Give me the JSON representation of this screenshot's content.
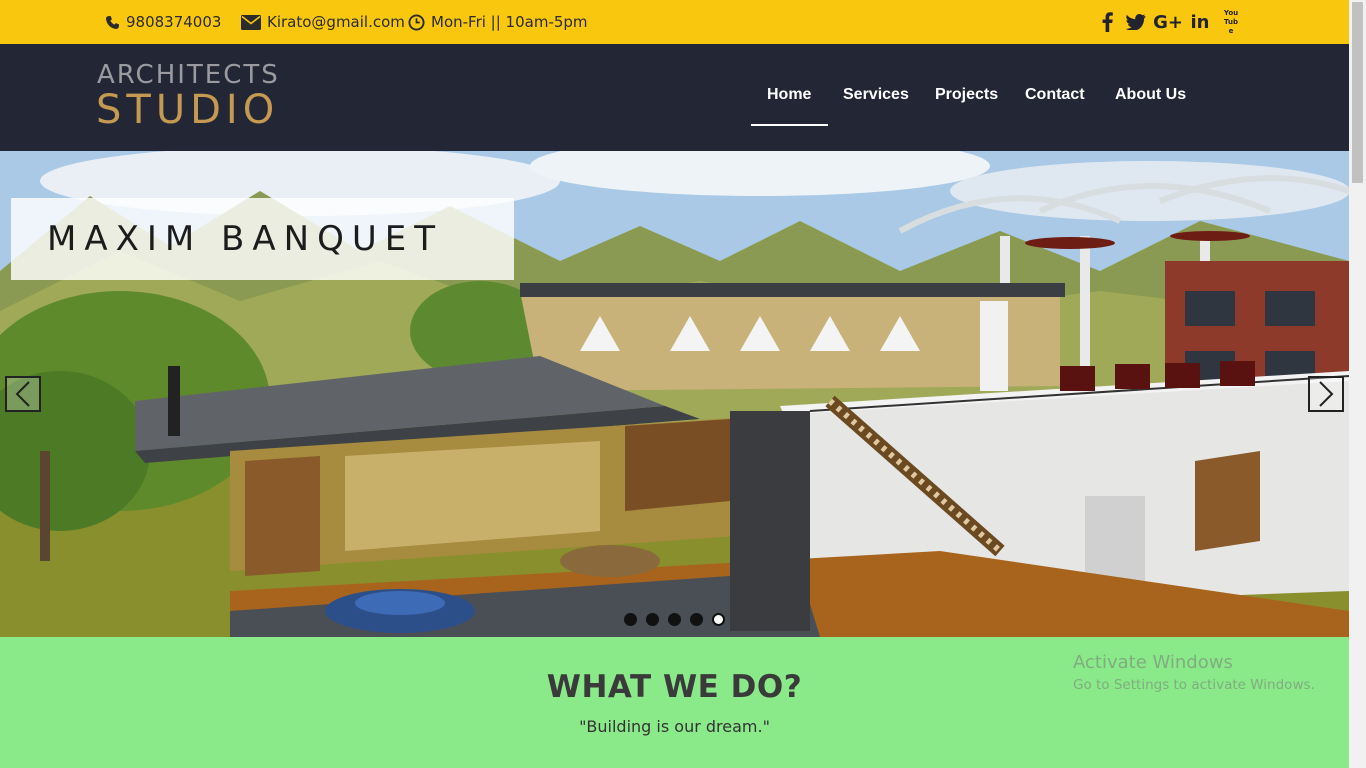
{
  "topbar": {
    "phone": "9808374003",
    "email": "Kirato@gmail.com",
    "hours": "Mon-Fri || 10am-5pm",
    "social": {
      "facebook": "facebook-icon",
      "twitter": "twitter-icon",
      "googleplus_label": "G+",
      "linkedin_label": "in",
      "youtube_label": "You Tube"
    },
    "color": "#f9c80e"
  },
  "logo": {
    "line1": "ARCHITECTS",
    "line2": "STUDIO",
    "line1_color": "#9a9aa0",
    "line2_color": "#c49a52"
  },
  "nav": {
    "items": [
      "Home",
      "Services",
      "Projects",
      "Contact",
      "About Us"
    ],
    "active": "Home",
    "background": "#232634"
  },
  "hero": {
    "caption": "MAXIM BANQUET",
    "prev_icon": "chevron-left-icon",
    "next_icon": "chevron-right-icon",
    "slide_count": 5,
    "active_slide": 5
  },
  "section": {
    "title": "WHAT WE DO?",
    "quote": "\"Building is our dream.\"",
    "background": "#8aea8a"
  },
  "watermark": {
    "title": "Activate Windows",
    "subtitle": "Go to Settings to activate Windows."
  }
}
